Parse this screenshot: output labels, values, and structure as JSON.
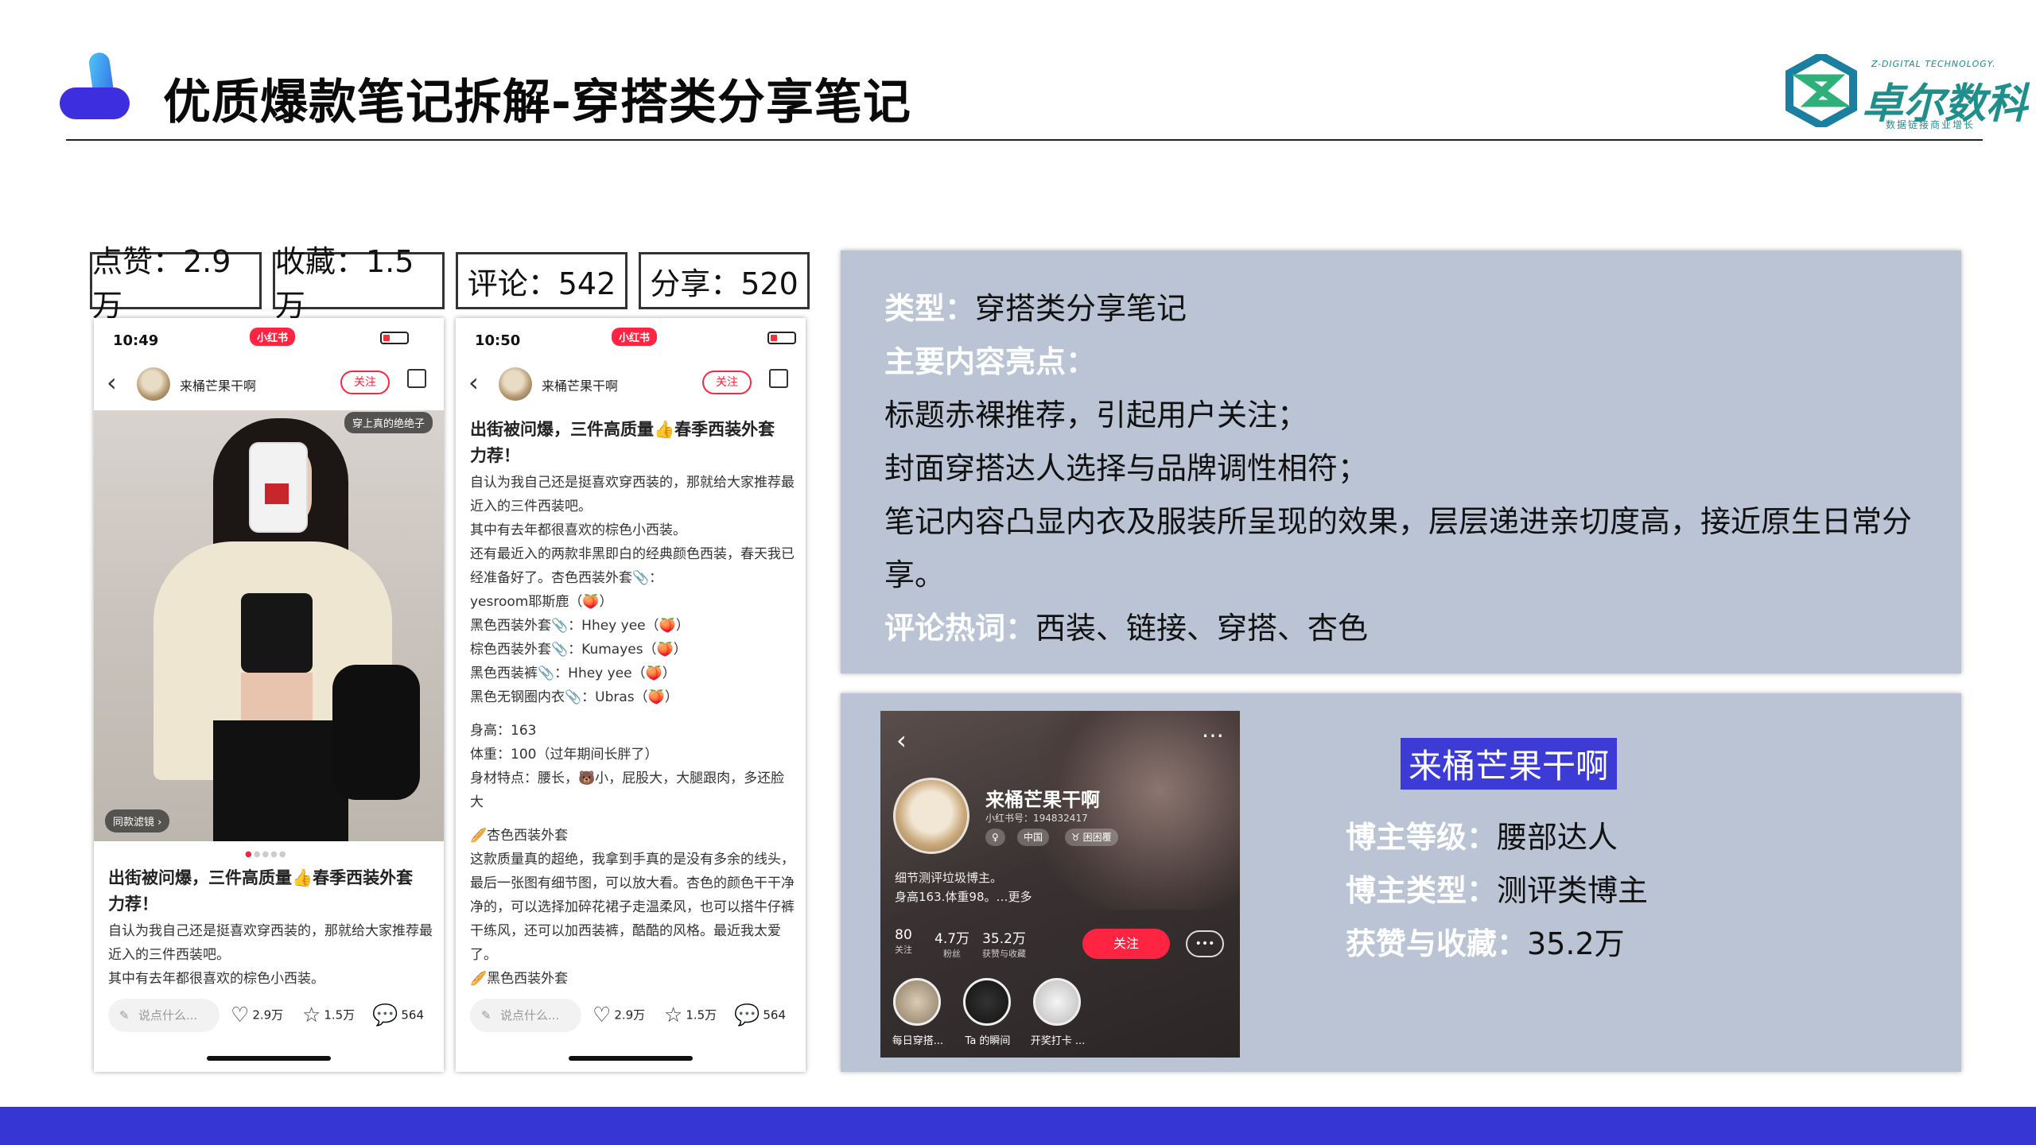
{
  "header": {
    "title": "优质爆款笔记拆解-穿搭类分享笔记",
    "brand_en": "Z-DIGITAL TECHNOLOGY.",
    "brand_cn": "卓尔数科",
    "brand_tagline": "数据链接商业增长"
  },
  "stats": [
    {
      "label": "点赞：2.9万"
    },
    {
      "label": "收藏：1.5万"
    },
    {
      "label": "评论：542"
    },
    {
      "label": "分享：520"
    }
  ],
  "phone1": {
    "time": "10:49",
    "badge": "小红书",
    "author": "来桶芒果干啊",
    "follow": "关注",
    "photo_tag": "穿上真的绝绝子",
    "photo_filter": "同款滤镜 ›",
    "title": "出街被问爆，三件高质量👍春季西装外套力荐！",
    "body": [
      "自认为我自己还是挺喜欢穿西装的，那就给大家推荐最近入的三件西装吧。",
      "其中有去年都很喜欢的棕色小西装。"
    ],
    "comment_placeholder": "说点什么...",
    "likes": "2.9万",
    "collects": "1.5万",
    "comments": "564"
  },
  "phone2": {
    "time": "10:50",
    "badge": "小红书",
    "author": "来桶芒果干啊",
    "follow": "关注",
    "title": "出街被问爆，三件高质量👍春季西装外套力荐！",
    "body": [
      "自认为我自己还是挺喜欢穿西装的，那就给大家推荐最近入的三件西装吧。",
      "其中有去年都很喜欢的棕色小西装。",
      "还有最近入的两款非黑即白的经典颜色西装，春天我已经准备好了。杏色西装外套📎：",
      "yesroom耶斯鹿（🍑）",
      "黑色西装外套📎：Hhey yee（🍑）",
      "棕色西装外套📎：Kumayes（🍑）",
      "黑色西装裤📎：Hhey yee（🍑）",
      "黑色无钢圈内衣📎：Ubras（🍑）"
    ],
    "body2": [
      "身高：163",
      "体重：100（过年期间长胖了）",
      "身材特点：腰长，🐻小，屁股大，大腿跟肉，多还脸大"
    ],
    "body3": [
      "🥖杏色西装外套",
      "这款质量真的超绝，我拿到手真的是没有多余的线头，最后一张图有细节图，可以放大看。杏色的颜色干干净净的，可以选择加碎花裙子走温柔风，也可以搭牛仔裤干练风，还可以加西装裤，酷酷的风格。最近我太爱了。",
      "🥖黑色西装外套"
    ],
    "comment_placeholder": "说点什么...",
    "likes": "2.9万",
    "collects": "1.5万",
    "comments": "564"
  },
  "analysis": {
    "type_key": "类型：",
    "type_val": "穿搭类分享笔记",
    "highlights_key": "主要内容亮点：",
    "highlights": [
      "标题赤裸推荐，引起用户关注；",
      "封面穿搭达人选择与品牌调性相符；",
      "笔记内容凸显内衣及服装所呈现的效果，层层递进亲切度高，接近原生日常分",
      "享。"
    ],
    "keywords_key": "评论热词：",
    "keywords_val": "西装、链接、穿搭、杏色"
  },
  "profile": {
    "name": "来桶芒果干啊",
    "id": "小红书号：194832417",
    "chips": [
      "♀",
      "中国",
      "♉ 困困覆"
    ],
    "bio": [
      "细节测评垃圾博主。",
      "身高163.体重98。…更多"
    ],
    "stats": [
      {
        "n": "80",
        "l": "关注"
      },
      {
        "n": "4.7万",
        "l": "粉丝"
      },
      {
        "n": "35.2万",
        "l": "获赞与收藏"
      }
    ],
    "follow": "关注",
    "collections": [
      "每日穿搭...",
      "Ta 的瞬间",
      "开奖打卡 ..."
    ]
  },
  "blogger": {
    "name": "来桶芒果干啊",
    "level_key": "博主等级：",
    "level_val": "腰部达人",
    "type_key": "博主类型：",
    "type_val": "测评类博主",
    "likes_key": "获赞与收藏：",
    "likes_val": "35.2万"
  },
  "colors": {
    "accent": "#3636d4",
    "panel": "#bac4d4",
    "redbook": "#ff2442",
    "brand": "#1e8f8a"
  }
}
